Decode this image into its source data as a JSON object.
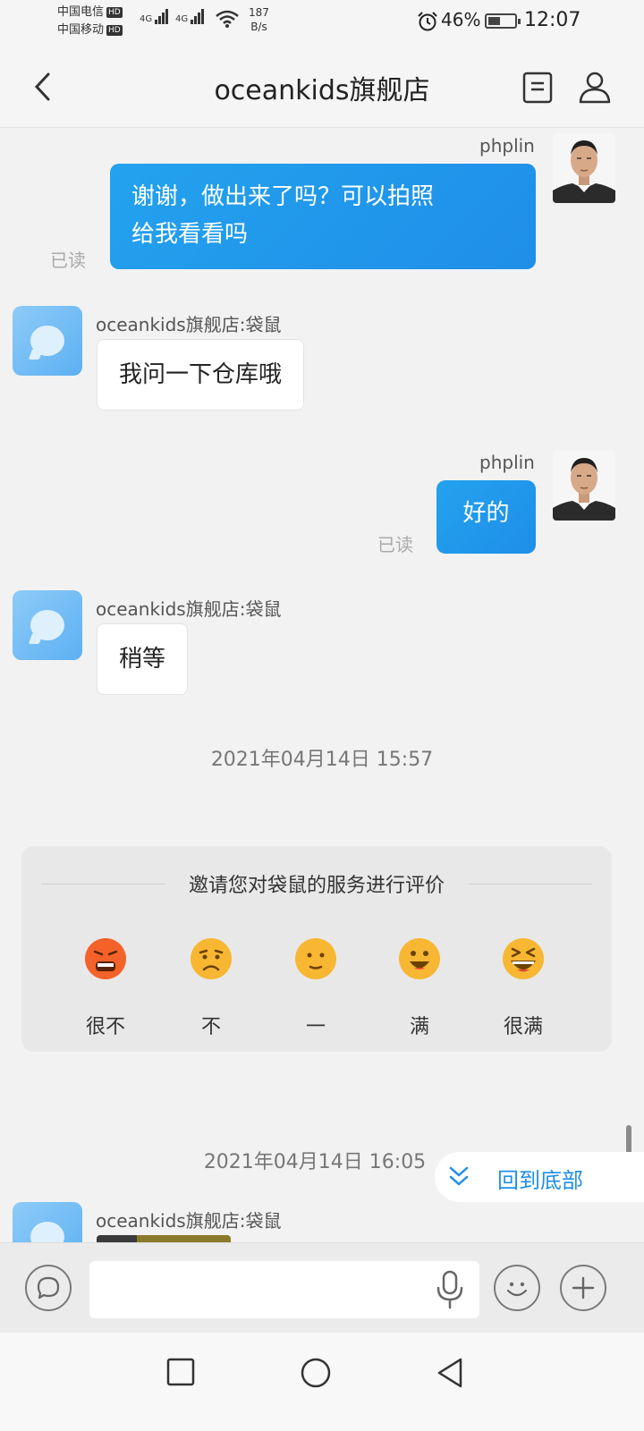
{
  "status_bar": {
    "carrier1": "中国电信",
    "carrier2": "中国移动",
    "hd": "HD",
    "net1": "4G",
    "net2": "4G",
    "speed_value": "187",
    "speed_unit": "B/s",
    "battery": "46%",
    "battery_level": 0.46,
    "time": "12:07"
  },
  "header": {
    "back_icon": "chevron-left-icon",
    "title": "oceankids旗舰店",
    "doc_icon": "document-icon",
    "profile_icon": "person-icon"
  },
  "messages": [
    {
      "from": "me",
      "sender": "phplin",
      "lines": [
        "谢谢，做出来了吗？可以拍照",
        "给我看看吗"
      ],
      "status": "已读"
    },
    {
      "from": "shop",
      "sender": "oceankids旗舰店:袋鼠",
      "text": "我问一下仓库哦"
    },
    {
      "from": "me",
      "sender": "phplin",
      "text": "好的",
      "status": "已读"
    },
    {
      "from": "shop",
      "sender": "oceankids旗舰店:袋鼠",
      "text": "稍等"
    }
  ],
  "timestamps": [
    "2021年04月14日 15:57",
    "2021年04月14日 16:05"
  ],
  "rating": {
    "title": "邀请您对袋鼠的服务进行评价",
    "options": [
      {
        "label": "很不",
        "icon": "angry-face-icon",
        "color": "#f4622a"
      },
      {
        "label": "不",
        "icon": "frown-face-icon",
        "color": "#f7b733"
      },
      {
        "label": "一",
        "icon": "neutral-face-icon",
        "color": "#f7b733"
      },
      {
        "label": "满",
        "icon": "smile-face-icon",
        "color": "#f7b733"
      },
      {
        "label": "很满",
        "icon": "laugh-face-icon",
        "color": "#f7b733"
      }
    ]
  },
  "last_sender": "oceankids旗舰店:袋鼠",
  "back_to_bottom": "回到底部",
  "input": {
    "placeholder": ""
  },
  "colors": {
    "accent": "#1f8ee8",
    "background": "#f2f2f2"
  }
}
